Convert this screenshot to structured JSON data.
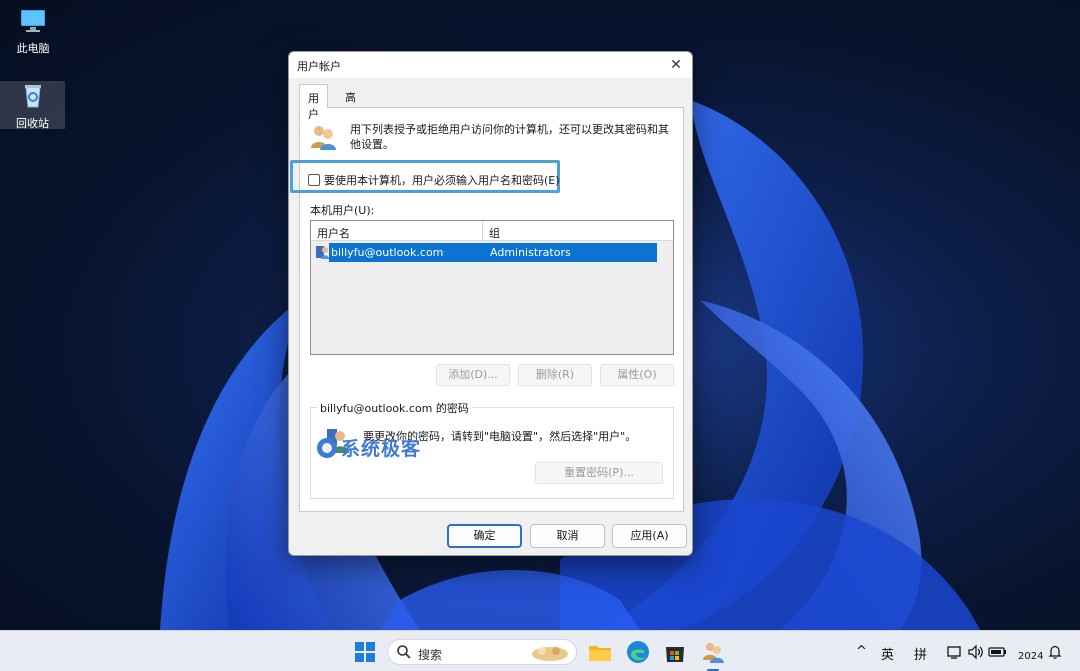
{
  "desktop": {
    "icons": [
      {
        "label": "此电脑"
      },
      {
        "label": "回收站"
      }
    ]
  },
  "dialog": {
    "title": "用户帐户",
    "close_glyph": "✕",
    "tabs": [
      {
        "label": "用户",
        "active": true
      },
      {
        "label": "高级",
        "active": false
      }
    ],
    "intro_text": "用下列表授予或拒绝用户访问你的计算机，还可以更改其密码和其他设置。",
    "require_password": {
      "label": "要使用本计算机，用户必须输入用户名和密码(E)",
      "checked": false
    },
    "local_users_label": "本机用户(U):",
    "columns": [
      "用户名",
      "组"
    ],
    "users": [
      {
        "name": "billyfu@outlook.com",
        "group": "Administrators",
        "selected": true
      }
    ],
    "list_buttons": {
      "add": "添加(D)...",
      "remove": "删除(R)",
      "properties": "属性(O)"
    },
    "password_group": {
      "title": "billyfu@outlook.com 的密码",
      "text": "要更改你的密码，请转到\"电脑设置\"，然后选择\"用户\"。",
      "reset_button": "重置密码(P)..."
    },
    "watermark": "系统极客",
    "buttons": {
      "ok": "确定",
      "cancel": "取消",
      "apply": "应用(A)"
    }
  },
  "taskbar": {
    "search_placeholder": "搜索",
    "tray": {
      "input_lang": "英",
      "ime": "拼",
      "chevron": "^",
      "year": "2024"
    }
  },
  "colors": {
    "selection": "#0a74d0",
    "highlight_box": "#4aa0d8",
    "watermark": "#3f7bd4"
  }
}
